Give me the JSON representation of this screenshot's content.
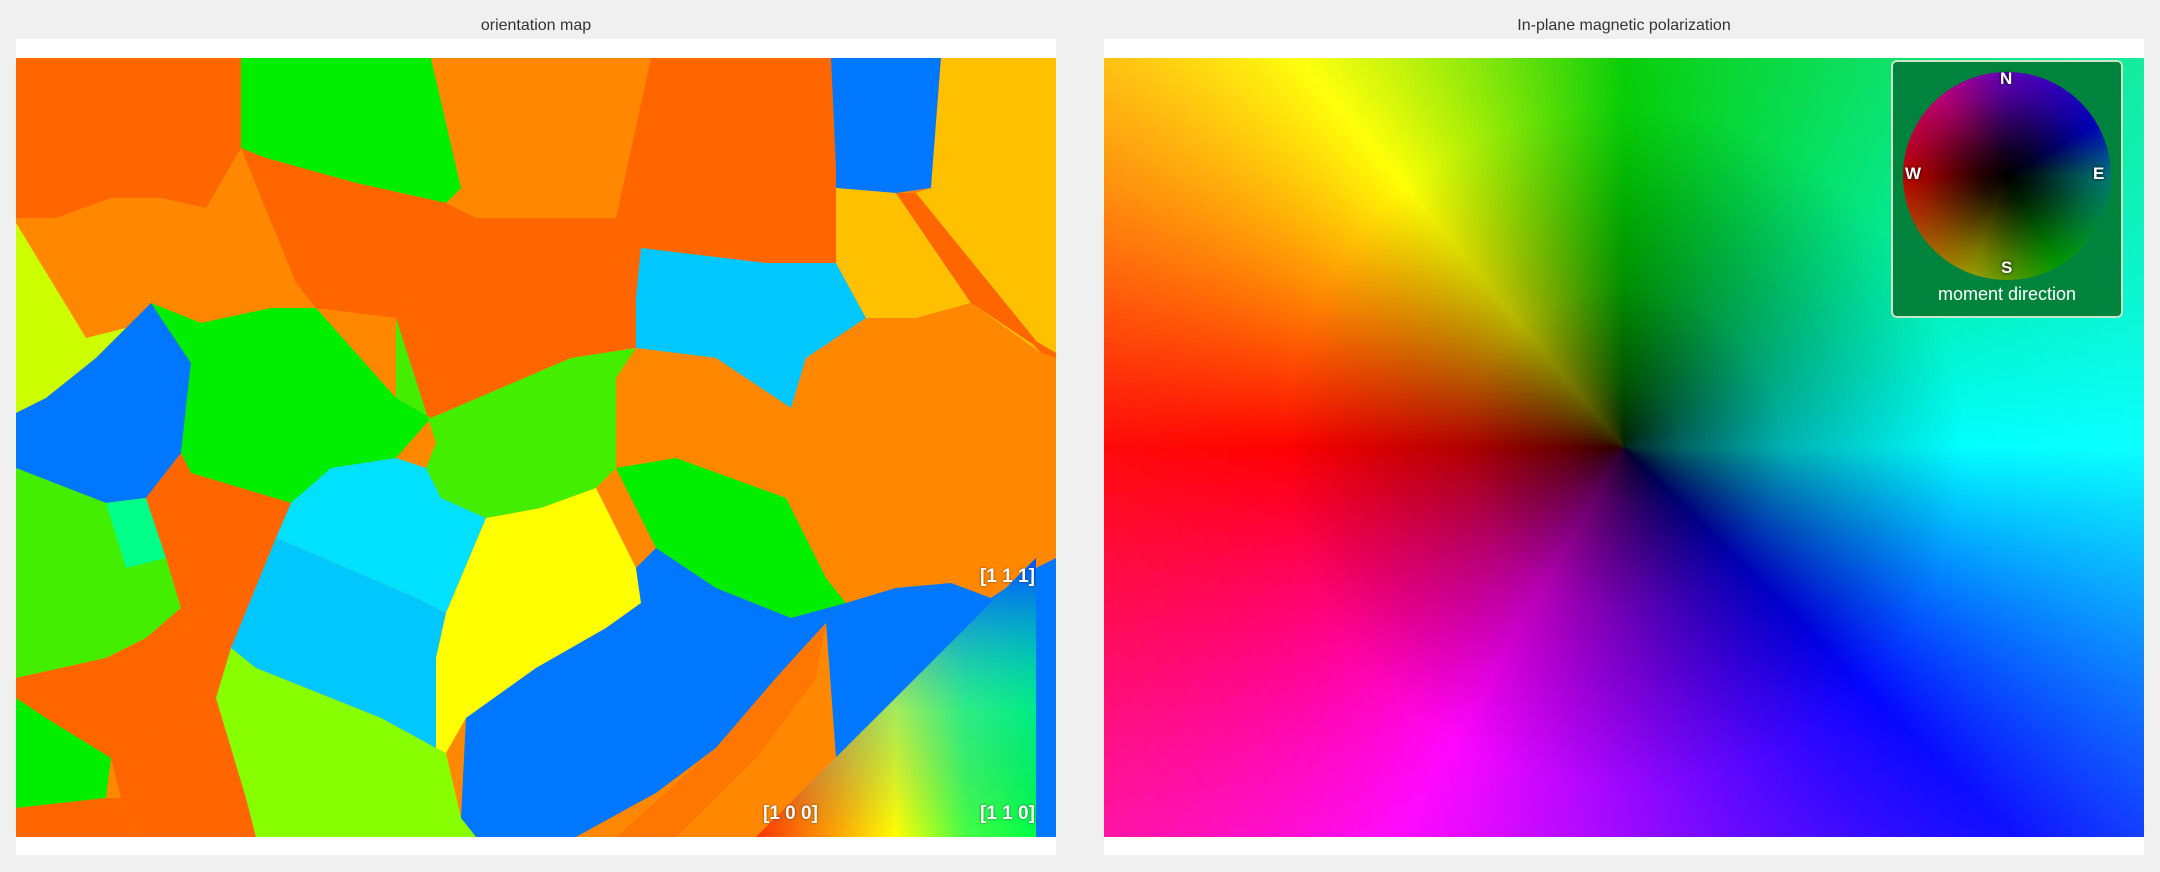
{
  "left_panel": {
    "title": "orientation map",
    "legend": {
      "corner_111": "[1 1 1]",
      "corner_100": "[1 0 0]",
      "corner_110": "[1 1 0]"
    }
  },
  "right_panel": {
    "title": "In-plane magnetic polarization",
    "compass": {
      "north": "N",
      "south": "S",
      "east": "E",
      "west": "W",
      "caption": "moment direction",
      "background_color": "#00833c"
    }
  },
  "colors": {
    "page_background": "#f0f0f0",
    "frame": "#ffffff",
    "grain_orange_red": "#ff6600",
    "grain_orange": "#ff8800",
    "grain_amber": "#ffc000",
    "grain_green": "#00ee00",
    "grain_lime": "#88ff00",
    "grain_yellow": "#ffff00",
    "grain_blue": "#0077ff",
    "grain_cyan": "#00c8ff"
  }
}
